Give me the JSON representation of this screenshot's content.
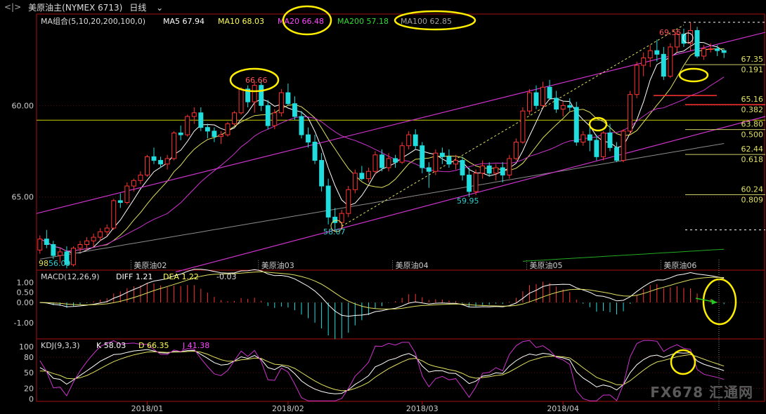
{
  "header": {
    "symbol": "美原油主(NYMEX 6713)",
    "period": "日线",
    "nav_icon_label": "<|>"
  },
  "ma_legend": {
    "group": "MA组合(5,10,20,200,100,0)",
    "items": [
      {
        "label": "MA5 67.94",
        "color": "#ffffff"
      },
      {
        "label": "MA10 68.03",
        "color": "#ffff55"
      },
      {
        "label": "MA20 66.48",
        "color": "#ff44ff"
      },
      {
        "label": "MA200 57.18",
        "color": "#33dd33"
      },
      {
        "label": "MA100 62.85",
        "color": "#a0a0a0"
      }
    ]
  },
  "macd_legend": {
    "label": "MACD(12,26,9)",
    "diff": "DIFF 1.21",
    "dea": "DEA 1.22",
    "macd": "-0.03"
  },
  "kdj_legend": {
    "label": "KDJ(9,3,3)",
    "k": "K 58.03",
    "d": "D 66.35",
    "j": "J 41.38"
  },
  "price_axis": {
    "ticks": [
      "65.00",
      "60.00"
    ]
  },
  "macd_axis": {
    "ticks": [
      "1.00",
      "0.50",
      "0.00",
      "-1.00"
    ]
  },
  "kdj_axis": {
    "ticks": [
      "100",
      "80",
      "50",
      "20",
      "0"
    ]
  },
  "contract_labels": [
    "美原油02",
    "美原油03",
    "美原油04",
    "美原油05",
    "美原油06"
  ],
  "date_labels": [
    "2018/01",
    "2018/02",
    "2018/03",
    "2018/04"
  ],
  "fib_levels": [
    {
      "price": "67.35",
      "ratio": "0.191"
    },
    {
      "price": "65.16",
      "ratio": "0.382"
    },
    {
      "price": "63.80",
      "ratio": "0.500"
    },
    {
      "price": "62.44",
      "ratio": "0.618"
    },
    {
      "price": "60.24",
      "ratio": "0.809"
    }
  ],
  "annotations": {
    "high_1": "66.66",
    "high_2": "69.55",
    "low_1": "58.07",
    "low_2": "59.95",
    "low_3": "56.09",
    "low_3_prefix": "98",
    "watermark": "FX678 汇通网"
  },
  "chart_data": {
    "type": "candlestick",
    "title": "美原油主(NYMEX 6713) 日线",
    "price_ylim": [
      56.0,
      70.0
    ],
    "price_ticks": [
      60.0,
      65.0
    ],
    "reference_line": 64.2,
    "fib": [
      67.35,
      65.16,
      63.8,
      62.44,
      60.24
    ],
    "ohlc": [
      [
        57.1,
        57.9,
        56.9,
        57.7
      ],
      [
        57.7,
        58.2,
        57.2,
        57.4
      ],
      [
        57.4,
        57.6,
        56.6,
        56.8
      ],
      [
        56.8,
        57.2,
        56.4,
        57.0
      ],
      [
        57.0,
        57.3,
        56.1,
        56.3
      ],
      [
        56.3,
        57.3,
        56.2,
        57.2
      ],
      [
        57.2,
        57.6,
        57.0,
        57.4
      ],
      [
        57.4,
        57.8,
        57.1,
        57.6
      ],
      [
        57.6,
        58.0,
        57.3,
        57.8
      ],
      [
        57.8,
        58.3,
        57.6,
        58.1
      ],
      [
        58.1,
        58.5,
        57.9,
        58.3
      ],
      [
        58.3,
        59.9,
        58.2,
        59.8
      ],
      [
        59.8,
        60.2,
        59.4,
        59.7
      ],
      [
        59.7,
        60.8,
        59.6,
        60.6
      ],
      [
        60.6,
        61.0,
        60.3,
        60.9
      ],
      [
        60.9,
        61.4,
        60.7,
        61.2
      ],
      [
        61.2,
        62.3,
        61.1,
        62.2
      ],
      [
        62.2,
        62.7,
        61.8,
        62.0
      ],
      [
        62.0,
        62.2,
        61.6,
        61.8
      ],
      [
        61.8,
        62.3,
        61.5,
        62.1
      ],
      [
        62.1,
        63.6,
        62.0,
        63.5
      ],
      [
        63.5,
        63.9,
        63.1,
        63.4
      ],
      [
        63.4,
        64.5,
        63.3,
        64.4
      ],
      [
        64.4,
        64.9,
        64.0,
        64.6
      ],
      [
        64.6,
        64.9,
        63.6,
        63.8
      ],
      [
        63.8,
        64.0,
        63.2,
        63.6
      ],
      [
        63.6,
        63.8,
        63.0,
        63.3
      ],
      [
        63.3,
        63.6,
        62.9,
        63.4
      ],
      [
        63.4,
        64.1,
        63.3,
        64.0
      ],
      [
        64.0,
        64.7,
        63.9,
        64.6
      ],
      [
        64.6,
        66.0,
        64.5,
        65.9
      ],
      [
        65.9,
        66.1,
        64.9,
        65.2
      ],
      [
        65.2,
        66.3,
        64.6,
        66.1
      ],
      [
        66.1,
        66.4,
        64.7,
        65.0
      ],
      [
        65.0,
        65.3,
        63.7,
        63.9
      ],
      [
        63.9,
        64.8,
        63.7,
        64.6
      ],
      [
        64.6,
        65.9,
        64.4,
        65.7
      ],
      [
        65.7,
        66.2,
        65.0,
        65.1
      ],
      [
        65.1,
        65.5,
        64.2,
        64.4
      ],
      [
        64.4,
        64.7,
        63.2,
        63.4
      ],
      [
        63.4,
        63.8,
        62.7,
        63.0
      ],
      [
        63.0,
        63.4,
        61.8,
        62.0
      ],
      [
        62.0,
        62.4,
        60.3,
        60.6
      ],
      [
        60.6,
        61.0,
        58.5,
        58.9
      ],
      [
        58.9,
        59.4,
        58.1,
        58.6
      ],
      [
        58.6,
        59.3,
        58.3,
        59.1
      ],
      [
        59.1,
        60.6,
        58.9,
        60.4
      ],
      [
        60.4,
        61.5,
        60.2,
        61.3
      ],
      [
        61.3,
        61.7,
        60.9,
        61.0
      ],
      [
        61.0,
        61.6,
        60.8,
        61.4
      ],
      [
        61.4,
        62.5,
        61.2,
        62.3
      ],
      [
        62.3,
        62.6,
        61.4,
        61.6
      ],
      [
        61.6,
        62.4,
        61.4,
        62.1
      ],
      [
        62.1,
        62.3,
        61.6,
        61.9
      ],
      [
        61.9,
        63.0,
        61.8,
        62.8
      ],
      [
        62.8,
        63.6,
        62.6,
        63.4
      ],
      [
        63.4,
        63.7,
        62.6,
        62.8
      ],
      [
        62.8,
        63.0,
        61.3,
        61.6
      ],
      [
        61.6,
        61.9,
        60.5,
        61.4
      ],
      [
        61.4,
        62.6,
        61.2,
        62.4
      ],
      [
        62.4,
        62.7,
        61.8,
        62.2
      ],
      [
        62.2,
        62.6,
        61.6,
        61.8
      ],
      [
        61.8,
        62.3,
        61.5,
        62.0
      ],
      [
        62.0,
        62.2,
        60.9,
        61.2
      ],
      [
        61.2,
        61.6,
        60.0,
        60.3
      ],
      [
        60.3,
        61.5,
        60.1,
        61.3
      ],
      [
        61.3,
        62.0,
        61.0,
        61.7
      ],
      [
        61.7,
        61.9,
        61.1,
        61.3
      ],
      [
        61.3,
        61.8,
        60.9,
        61.6
      ],
      [
        61.6,
        61.9,
        60.8,
        61.2
      ],
      [
        61.2,
        62.3,
        61.0,
        62.1
      ],
      [
        62.1,
        63.2,
        62.0,
        63.0
      ],
      [
        63.0,
        64.9,
        62.9,
        64.7
      ],
      [
        64.7,
        65.9,
        64.5,
        65.7
      ],
      [
        65.7,
        66.1,
        64.8,
        65.0
      ],
      [
        65.0,
        66.3,
        64.9,
        66.0
      ],
      [
        66.0,
        66.4,
        65.3,
        65.4
      ],
      [
        65.4,
        65.8,
        64.6,
        64.8
      ],
      [
        64.8,
        65.2,
        64.4,
        65.0
      ],
      [
        65.0,
        65.4,
        64.7,
        64.9
      ],
      [
        64.9,
        65.2,
        62.8,
        63.0
      ],
      [
        63.0,
        63.6,
        62.8,
        63.4
      ],
      [
        63.4,
        64.0,
        62.5,
        63.1
      ],
      [
        63.1,
        63.4,
        62.0,
        62.2
      ],
      [
        62.2,
        63.6,
        62.0,
        63.5
      ],
      [
        63.5,
        64.0,
        62.5,
        62.7
      ],
      [
        62.7,
        63.0,
        61.9,
        62.0
      ],
      [
        62.0,
        63.7,
        61.9,
        63.6
      ],
      [
        63.6,
        65.8,
        63.4,
        65.6
      ],
      [
        65.6,
        67.4,
        65.4,
        67.2
      ],
      [
        67.2,
        67.9,
        66.6,
        67.6
      ],
      [
        67.6,
        68.3,
        67.1,
        68.0
      ],
      [
        68.0,
        68.6,
        67.4,
        67.8
      ],
      [
        67.8,
        68.2,
        66.4,
        66.6
      ],
      [
        66.6,
        68.4,
        66.5,
        68.2
      ],
      [
        68.2,
        69.1,
        67.9,
        68.9
      ],
      [
        68.9,
        69.2,
        68.2,
        68.4
      ],
      [
        68.4,
        69.55,
        68.0,
        69.1
      ],
      [
        69.1,
        69.3,
        67.6,
        67.7
      ],
      [
        67.7,
        68.3,
        67.5,
        68.1
      ],
      [
        68.1,
        68.4,
        67.9,
        68.1
      ],
      [
        68.1,
        68.3,
        67.7,
        68.0
      ],
      [
        68.0,
        68.1,
        67.6,
        67.9
      ]
    ],
    "series": [
      {
        "name": "MA5",
        "value": 67.94
      },
      {
        "name": "MA10",
        "value": 68.03
      },
      {
        "name": "MA20",
        "value": 66.48
      },
      {
        "name": "MA200",
        "value": 57.18
      },
      {
        "name": "MA100",
        "value": 62.85
      }
    ],
    "macd": {
      "ylim": [
        -1.8,
        1.6
      ],
      "diff": 1.21,
      "dea": 1.22,
      "macd": -0.03
    },
    "kdj": {
      "ylim": [
        -5,
        115
      ],
      "k": 58.03,
      "d": 66.35,
      "j": 41.38
    }
  }
}
